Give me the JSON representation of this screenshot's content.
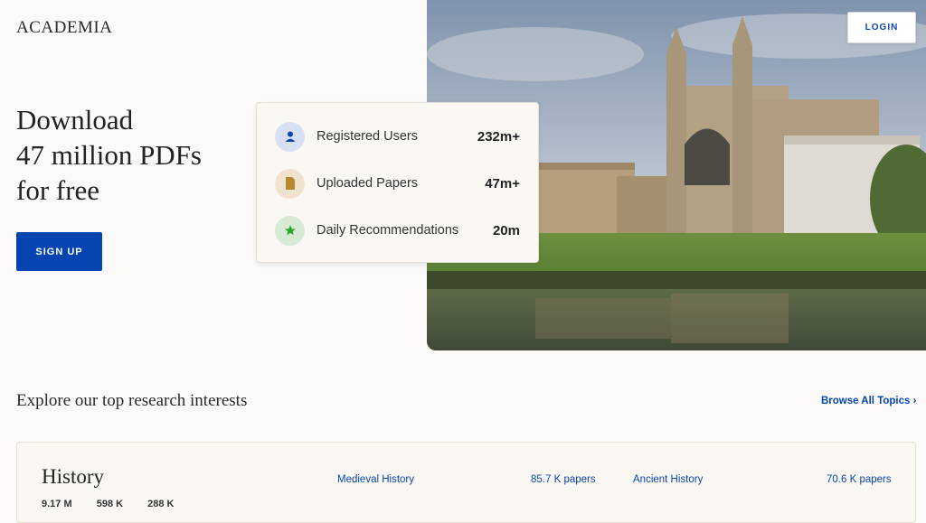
{
  "header": {
    "logo": "ACADEMIA",
    "login_label": "LOGIN"
  },
  "hero": {
    "title_lines": [
      "Download",
      "47 million PDFs",
      "for free"
    ],
    "signup_label": "SIGN UP"
  },
  "stats": [
    {
      "label": "Registered Users",
      "value": "232m+",
      "icon": "user-icon",
      "icon_bg": "#d6e0f2",
      "icon_color": "#0645b1"
    },
    {
      "label": "Uploaded Papers",
      "value": "47m+",
      "icon": "document-icon",
      "icon_bg": "#efe3cf",
      "icon_color": "#b58a2e"
    },
    {
      "label": "Daily Recommendations",
      "value": "20m",
      "icon": "star-icon",
      "icon_bg": "#d6ead6",
      "icon_color": "#2ba62b"
    }
  ],
  "explore": {
    "title": "Explore our top research interests",
    "browse_label": "Browse All Topics ›"
  },
  "topics": [
    {
      "title": "History",
      "stats": [
        "9.17 M",
        "598 K",
        "288 K"
      ],
      "subtopics": [
        {
          "name": "Medieval History",
          "count": "85.7 K papers"
        },
        {
          "name": "Ancient History",
          "count": "70.6 K papers"
        }
      ]
    }
  ],
  "colors": {
    "accent": "#0645b1",
    "background": "#fbfaf8",
    "card_background": "#fbf8f4"
  }
}
